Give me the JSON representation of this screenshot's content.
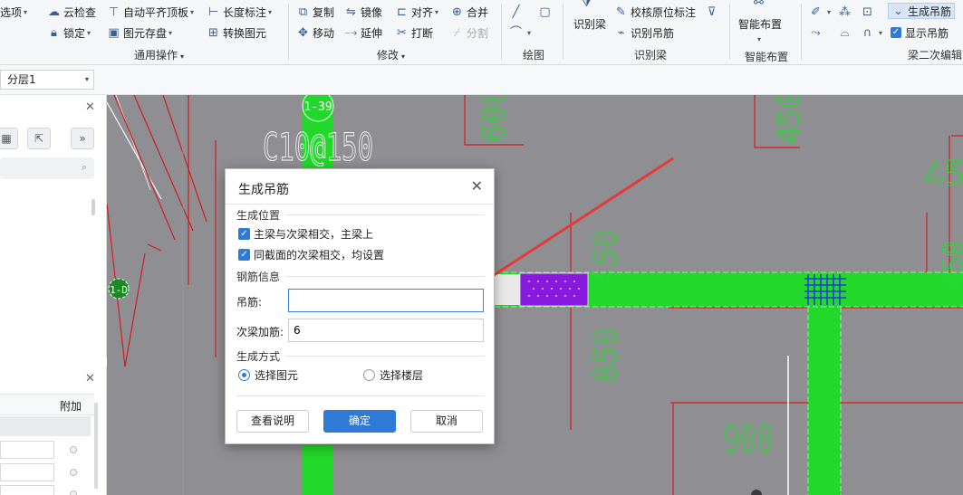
{
  "ribbon": {
    "items": [
      {
        "id": "options",
        "label": "选项",
        "icon": "settings-icon",
        "dropdown": true
      },
      {
        "id": "cloud-check",
        "label": "云检查",
        "icon": "cloud-icon",
        "dropdown": false
      },
      {
        "id": "lock",
        "label": "锁定",
        "icon": "lock-icon",
        "dropdown": true
      },
      {
        "id": "auto-align-top",
        "label": "自动平齐顶板",
        "icon": "align-top-icon",
        "dropdown": true
      },
      {
        "id": "element-store",
        "label": "图元存盘",
        "icon": "save-element-icon",
        "dropdown": true
      },
      {
        "id": "length-mark",
        "label": "长度标注",
        "icon": "dimension-icon",
        "dropdown": true
      },
      {
        "id": "convert-element",
        "label": "转换图元",
        "icon": "convert-icon",
        "dropdown": false
      },
      {
        "id": "copy",
        "label": "复制",
        "icon": "copy-icon",
        "dropdown": false
      },
      {
        "id": "mirror",
        "label": "镜像",
        "icon": "mirror-icon",
        "dropdown": false
      },
      {
        "id": "align",
        "label": "对齐",
        "icon": "align-icon",
        "dropdown": true
      },
      {
        "id": "merge",
        "label": "合并",
        "icon": "merge-icon",
        "dropdown": false
      },
      {
        "id": "move",
        "label": "移动",
        "icon": "move-icon",
        "dropdown": false
      },
      {
        "id": "extend",
        "label": "延伸",
        "icon": "extend-icon",
        "dropdown": false
      },
      {
        "id": "break",
        "label": "打断",
        "icon": "break-icon",
        "dropdown": false
      },
      {
        "id": "split",
        "label": "分割",
        "icon": "split-icon",
        "dropdown": false,
        "disabled": true
      },
      {
        "id": "identify-beam",
        "label": "识别梁",
        "icon": "identify-beam-icon",
        "dropdown": false
      },
      {
        "id": "check-origin-mark",
        "label": "校核原位标注",
        "icon": "check-mark-icon",
        "dropdown": false
      },
      {
        "id": "identify-hanger",
        "label": "识别吊筋",
        "icon": "identify-hanger-icon",
        "dropdown": false
      },
      {
        "id": "smart-layout",
        "label": "智能布置",
        "icon": "smart-layout-icon",
        "dropdown": true
      },
      {
        "id": "generate-hanger",
        "label": "生成吊筋",
        "icon": "generate-hanger-icon",
        "dropdown": false,
        "active": true
      },
      {
        "id": "show-hanger",
        "label": "显示吊筋",
        "checkbox": true,
        "checked": true
      }
    ],
    "groups": [
      {
        "id": "general-ops",
        "label": "通用操作",
        "dropdown": true
      },
      {
        "id": "modify",
        "label": "修改",
        "dropdown": true
      },
      {
        "id": "draw",
        "label": "绘图",
        "dropdown": false
      },
      {
        "id": "identify-beam-group",
        "label": "识别梁",
        "dropdown": false
      },
      {
        "id": "smart-layout-group",
        "label": "智能布置",
        "dropdown": false
      },
      {
        "id": "beam-secondary-edit",
        "label": "梁二次编辑",
        "dropdown": false
      }
    ]
  },
  "toolbar": {
    "layer_value": "分层1"
  },
  "left_panel": {
    "bottom_header": "附加"
  },
  "canvas": {
    "background": "#8f8e92",
    "beam_color": "#22d82a",
    "highlight_color": "#8a19e0",
    "line_color": "#d11d1d",
    "arrow_color": "#e53a3a",
    "labels": {
      "marker_1": "1-39",
      "rebar_spec": "C10@150",
      "marker_2": "1-D",
      "num_600": "600",
      "num_450_top": "450",
      "num_450_right": "450",
      "num_450_mid": "450",
      "num_850": "850",
      "num_900": "900",
      "num_45": "45"
    }
  },
  "dialog": {
    "title": "生成吊筋",
    "section_position": "生成位置",
    "opt_main_secondary": "主梁与次梁相交，主梁上",
    "opt_same_section": "同截面的次梁相交，均设置",
    "section_rebar": "钢筋信息",
    "hanger_label": "吊筋:",
    "hanger_value": "",
    "secondary_label": "次梁加筋:",
    "secondary_value": "6",
    "section_method": "生成方式",
    "radio_select_element": "选择图元",
    "radio_select_floor": "选择楼层",
    "btn_help": "查看说明",
    "btn_ok": "确定",
    "btn_cancel": "取消",
    "accent": "#2f7ad6"
  }
}
